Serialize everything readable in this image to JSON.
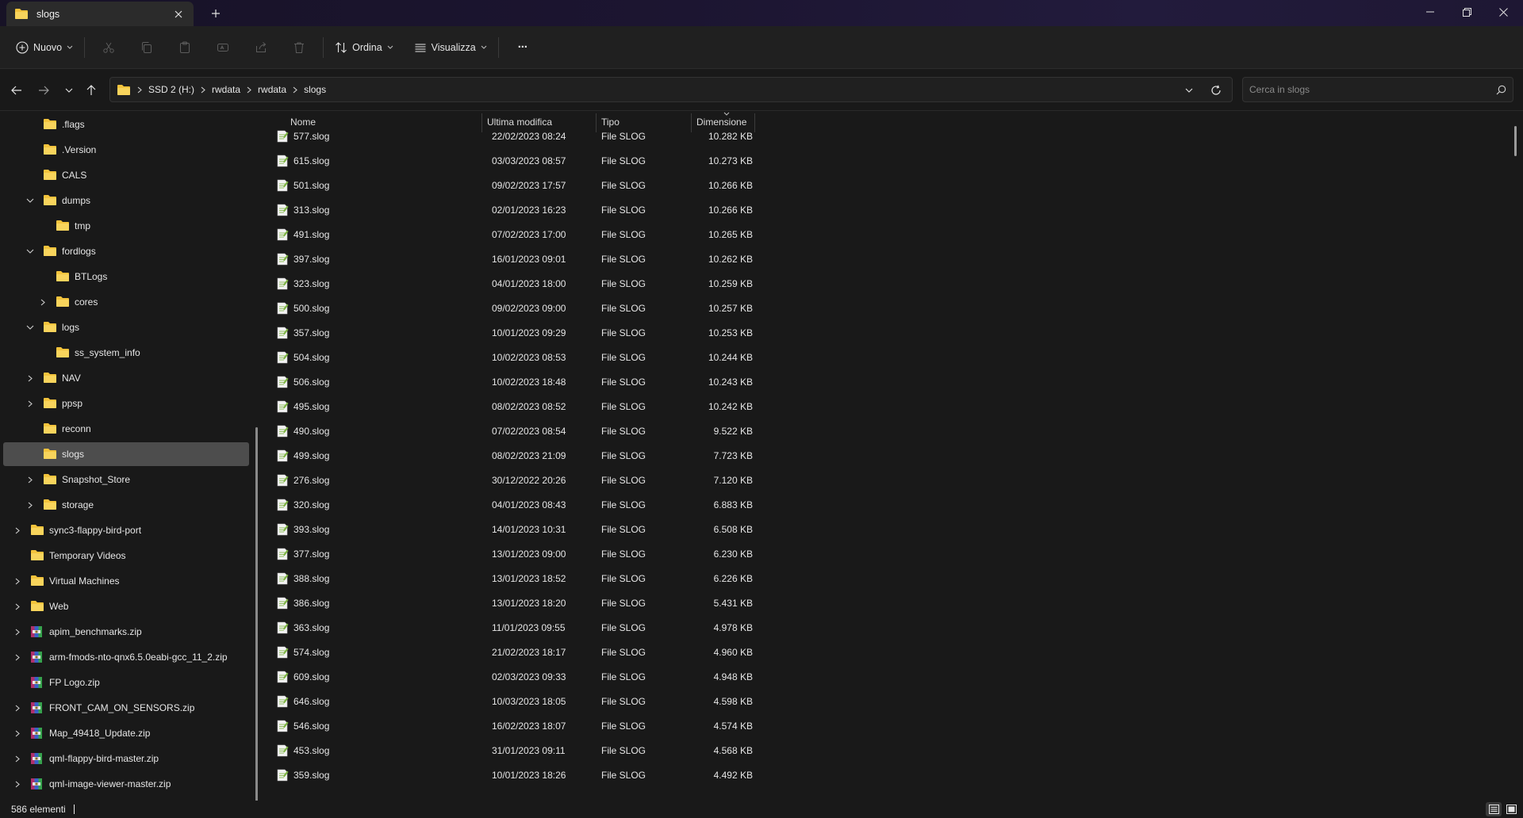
{
  "window": {
    "tab_title": "slogs",
    "colors": {
      "folder": "#f3c33c",
      "accent": "#4cc2ff",
      "selected": "#4d4d4d"
    }
  },
  "toolbar": {
    "new_label": "Nuovo",
    "sort_label": "Ordina",
    "view_label": "Visualizza",
    "more_label": "···"
  },
  "address": {
    "crumbs": [
      "SSD 2 (H:)",
      "rwdata",
      "rwdata",
      "slogs"
    ]
  },
  "search": {
    "placeholder": "Cerca in slogs"
  },
  "sidebar": {
    "items": [
      {
        "label": ".flags",
        "icon": "folder-icon"
      },
      {
        "label": ".Version",
        "icon": "folder-icon"
      },
      {
        "label": "CALS",
        "icon": "folder-icon"
      },
      {
        "label": "dumps",
        "icon": "folder-icon",
        "expanded": true
      },
      {
        "label": "tmp",
        "icon": "folder-icon"
      },
      {
        "label": "fordlogs",
        "icon": "folder-icon",
        "expanded": true
      },
      {
        "label": "BTLogs",
        "icon": "folder-icon"
      },
      {
        "label": "cores",
        "icon": "folder-icon",
        "collapsed": true
      },
      {
        "label": "logs",
        "icon": "folder-icon",
        "expanded": true
      },
      {
        "label": "ss_system_info",
        "icon": "folder-icon"
      },
      {
        "label": "NAV",
        "icon": "folder-icon",
        "collapsed": true
      },
      {
        "label": "ppsp",
        "icon": "folder-icon",
        "collapsed": true
      },
      {
        "label": "reconn",
        "icon": "folder-icon"
      },
      {
        "label": "slogs",
        "icon": "folder-icon",
        "selected": true
      },
      {
        "label": "Snapshot_Store",
        "icon": "folder-icon",
        "collapsed": true
      },
      {
        "label": "storage",
        "icon": "folder-icon",
        "collapsed": true
      },
      {
        "label": "sync3-flappy-bird-port",
        "icon": "folder-icon",
        "collapsed": true
      },
      {
        "label": "Temporary Videos",
        "icon": "folder-icon"
      },
      {
        "label": "Virtual Machines",
        "icon": "folder-icon",
        "collapsed": true
      },
      {
        "label": "Web",
        "icon": "folder-icon",
        "collapsed": true
      },
      {
        "label": "apim_benchmarks.zip",
        "icon": "zip-archive-icon",
        "collapsed": true
      },
      {
        "label": "arm-fmods-nto-qnx6.5.0eabi-gcc_11_2.zip",
        "icon": "zip-archive-icon",
        "collapsed": true
      },
      {
        "label": "FP Logo.zip",
        "icon": "zip-archive-icon"
      },
      {
        "label": "FRONT_CAM_ON_SENSORS.zip",
        "icon": "zip-archive-icon",
        "collapsed": true
      },
      {
        "label": "Map_49418_Update.zip",
        "icon": "zip-archive-icon",
        "collapsed": true
      },
      {
        "label": "qml-flappy-bird-master.zip",
        "icon": "zip-archive-icon",
        "collapsed": true
      },
      {
        "label": "qml-image-viewer-master.zip",
        "icon": "zip-archive-icon",
        "collapsed": true
      }
    ]
  },
  "columns": {
    "name": "Nome",
    "modified": "Ultima modifica",
    "type": "Tipo",
    "size": "Dimensione"
  },
  "files": [
    {
      "name": "577.slog",
      "modified": "22/02/2023 08:24",
      "type": "File SLOG",
      "size": "10.282 KB"
    },
    {
      "name": "615.slog",
      "modified": "03/03/2023 08:57",
      "type": "File SLOG",
      "size": "10.273 KB"
    },
    {
      "name": "501.slog",
      "modified": "09/02/2023 17:57",
      "type": "File SLOG",
      "size": "10.266 KB"
    },
    {
      "name": "313.slog",
      "modified": "02/01/2023 16:23",
      "type": "File SLOG",
      "size": "10.266 KB"
    },
    {
      "name": "491.slog",
      "modified": "07/02/2023 17:00",
      "type": "File SLOG",
      "size": "10.265 KB"
    },
    {
      "name": "397.slog",
      "modified": "16/01/2023 09:01",
      "type": "File SLOG",
      "size": "10.262 KB"
    },
    {
      "name": "323.slog",
      "modified": "04/01/2023 18:00",
      "type": "File SLOG",
      "size": "10.259 KB"
    },
    {
      "name": "500.slog",
      "modified": "09/02/2023 09:00",
      "type": "File SLOG",
      "size": "10.257 KB"
    },
    {
      "name": "357.slog",
      "modified": "10/01/2023 09:29",
      "type": "File SLOG",
      "size": "10.253 KB"
    },
    {
      "name": "504.slog",
      "modified": "10/02/2023 08:53",
      "type": "File SLOG",
      "size": "10.244 KB"
    },
    {
      "name": "506.slog",
      "modified": "10/02/2023 18:48",
      "type": "File SLOG",
      "size": "10.243 KB"
    },
    {
      "name": "495.slog",
      "modified": "08/02/2023 08:52",
      "type": "File SLOG",
      "size": "10.242 KB"
    },
    {
      "name": "490.slog",
      "modified": "07/02/2023 08:54",
      "type": "File SLOG",
      "size": "9.522 KB"
    },
    {
      "name": "499.slog",
      "modified": "08/02/2023 21:09",
      "type": "File SLOG",
      "size": "7.723 KB"
    },
    {
      "name": "276.slog",
      "modified": "30/12/2022 20:26",
      "type": "File SLOG",
      "size": "7.120 KB"
    },
    {
      "name": "320.slog",
      "modified": "04/01/2023 08:43",
      "type": "File SLOG",
      "size": "6.883 KB"
    },
    {
      "name": "393.slog",
      "modified": "14/01/2023 10:31",
      "type": "File SLOG",
      "size": "6.508 KB"
    },
    {
      "name": "377.slog",
      "modified": "13/01/2023 09:00",
      "type": "File SLOG",
      "size": "6.230 KB"
    },
    {
      "name": "388.slog",
      "modified": "13/01/2023 18:52",
      "type": "File SLOG",
      "size": "6.226 KB"
    },
    {
      "name": "386.slog",
      "modified": "13/01/2023 18:20",
      "type": "File SLOG",
      "size": "5.431 KB"
    },
    {
      "name": "363.slog",
      "modified": "11/01/2023 09:55",
      "type": "File SLOG",
      "size": "4.978 KB"
    },
    {
      "name": "574.slog",
      "modified": "21/02/2023 18:17",
      "type": "File SLOG",
      "size": "4.960 KB"
    },
    {
      "name": "609.slog",
      "modified": "02/03/2023 09:33",
      "type": "File SLOG",
      "size": "4.948 KB"
    },
    {
      "name": "646.slog",
      "modified": "10/03/2023 18:05",
      "type": "File SLOG",
      "size": "4.598 KB"
    },
    {
      "name": "546.slog",
      "modified": "16/02/2023 18:07",
      "type": "File SLOG",
      "size": "4.574 KB"
    },
    {
      "name": "453.slog",
      "modified": "31/01/2023 09:11",
      "type": "File SLOG",
      "size": "4.568 KB"
    },
    {
      "name": "359.slog",
      "modified": "10/01/2023 18:26",
      "type": "File SLOG",
      "size": "4.492 KB"
    }
  ],
  "status": {
    "count": "586 elementi"
  }
}
